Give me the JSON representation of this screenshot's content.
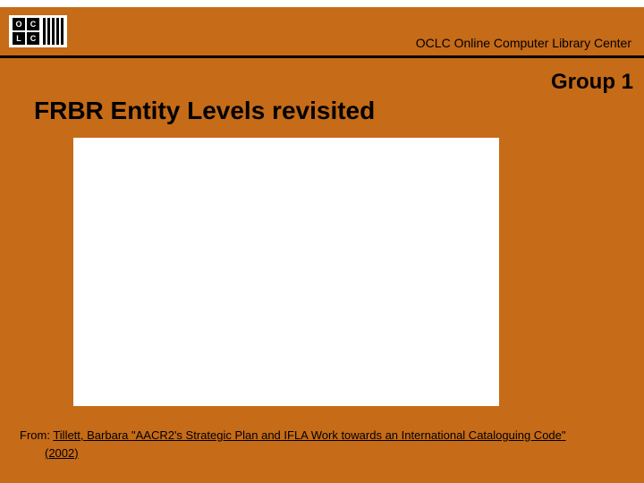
{
  "logo": {
    "letters": [
      "O",
      "C",
      "L",
      "C"
    ]
  },
  "banner": {
    "text": "OCLC Online Computer Library Center"
  },
  "group_label": "Group 1",
  "title": "FRBR Entity Levels revisited",
  "citation": {
    "prefix": "From: ",
    "link_main": "Tillett, Barbara \"AACR2's Strategic Plan and  IFLA Work towards an International Cataloguing Code\"",
    "link_tail": "(2002)"
  }
}
